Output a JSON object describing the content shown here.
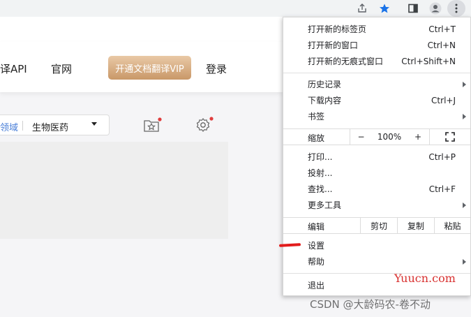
{
  "toolbar": {
    "icons": [
      "share-icon",
      "bookmark-star-icon",
      "side-panel-icon",
      "profile-icon",
      "kebab-menu-icon"
    ],
    "star_color": "#1a73e8"
  },
  "site": {
    "nav_api": "译API",
    "nav_official": "官网",
    "vip_button": "开通文档翻译VIP",
    "nav_login": "登录",
    "domain_field": "领域",
    "domain_value": "生物医药",
    "accent_color": "#4a7fd8",
    "badge_color": "#e03d3d"
  },
  "menu": {
    "new_tab": {
      "label": "打开新的标签页",
      "shortcut": "Ctrl+T"
    },
    "new_window": {
      "label": "打开新的窗口",
      "shortcut": "Ctrl+N"
    },
    "incognito": {
      "label": "打开新的无痕式窗口",
      "shortcut": "Ctrl+Shift+N"
    },
    "history": {
      "label": "历史记录"
    },
    "downloads": {
      "label": "下载内容",
      "shortcut": "Ctrl+J"
    },
    "bookmarks": {
      "label": "书签"
    },
    "zoom": {
      "label": "缩放",
      "minus": "−",
      "value": "100%",
      "plus": "+"
    },
    "print": {
      "label": "打印...",
      "shortcut": "Ctrl+P"
    },
    "cast": {
      "label": "投射..."
    },
    "find": {
      "label": "查找...",
      "shortcut": "Ctrl+F"
    },
    "more_tools": {
      "label": "更多工具"
    },
    "edit": {
      "label": "编辑",
      "cut": "剪切",
      "copy": "复制",
      "paste": "粘贴"
    },
    "settings": {
      "label": "设置"
    },
    "help": {
      "label": "帮助"
    },
    "exit": {
      "label": "退出"
    }
  },
  "watermarks": {
    "yuucn": "Yuucn.com",
    "csdn": "CSDN @大龄码农-卷不动"
  }
}
